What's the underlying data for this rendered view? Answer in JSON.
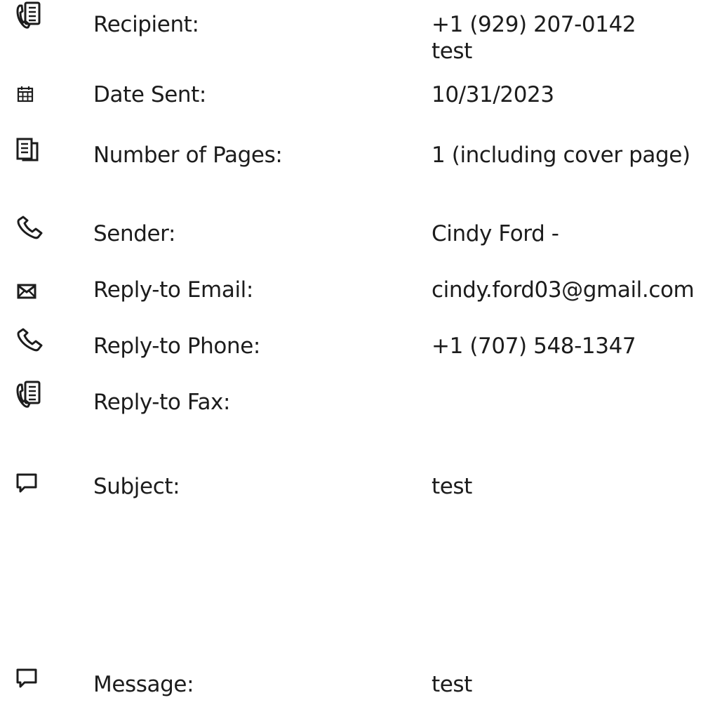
{
  "cover": {
    "recipient": {
      "icon": "fax-icon",
      "label": "Recipient:",
      "value_line1": "+1 (929) 207-0142",
      "value_line2": "test"
    },
    "date_sent": {
      "icon": "calendar-icon",
      "label": "Date Sent:",
      "value": "10/31/2023"
    },
    "pages": {
      "icon": "pages-icon",
      "label": "Number of Pages:",
      "value": "1 (including cover page)"
    },
    "sender": {
      "icon": "phone-icon",
      "label": "Sender:",
      "value": "Cindy Ford -"
    },
    "reply_email": {
      "icon": "envelope-icon",
      "label": "Reply-to Email:",
      "value": "cindy.ford03@gmail.com"
    },
    "reply_phone": {
      "icon": "phone-icon",
      "label": "Reply-to Phone:",
      "value": "+1 (707) 548-1347"
    },
    "reply_fax": {
      "icon": "fax-icon",
      "label": "Reply-to Fax:",
      "value": ""
    },
    "subject": {
      "icon": "comment-icon",
      "label": "Subject:",
      "value": "test"
    },
    "message": {
      "icon": "comment-icon",
      "label": "Message:",
      "value": "test"
    }
  }
}
